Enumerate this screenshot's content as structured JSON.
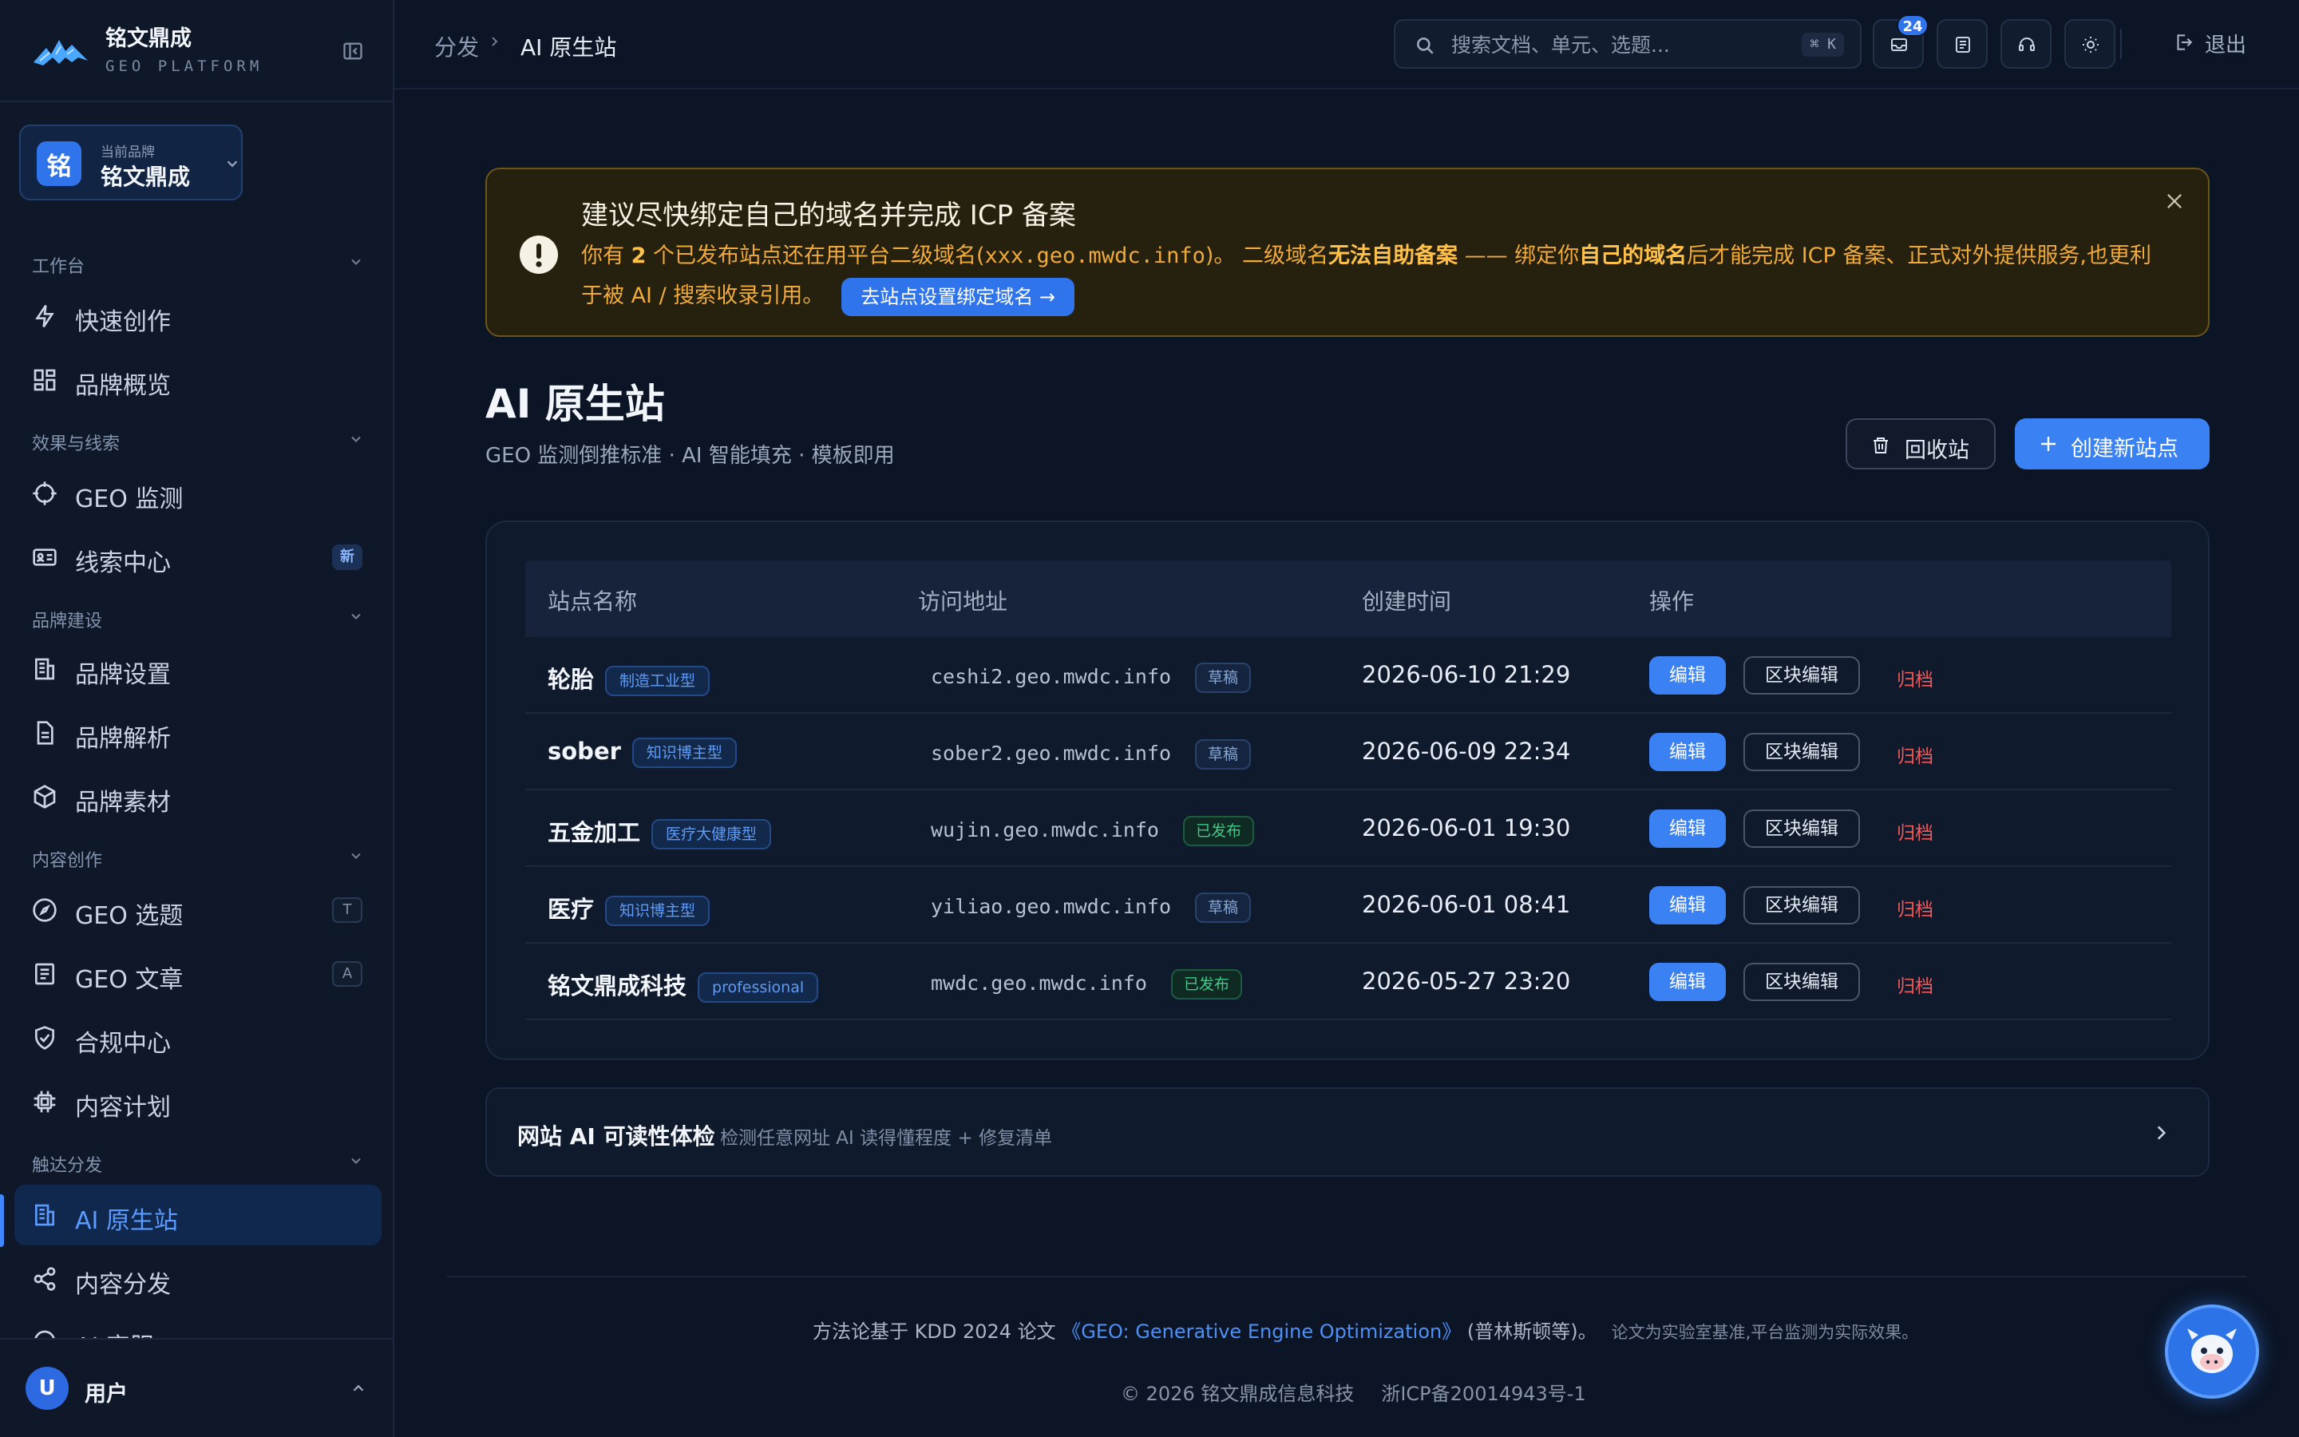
{
  "app": {
    "name": "铭文鼎成",
    "subtitle": "GEO PLATFORM"
  },
  "brand_switch": {
    "avatar": "铭",
    "label": "当前品牌",
    "name": "铭文鼎成"
  },
  "sidebar": {
    "sections": [
      {
        "title": "工作台"
      },
      {
        "title": "效果与线索"
      },
      {
        "title": "品牌建设"
      },
      {
        "title": "内容创作"
      },
      {
        "title": "触达分发"
      }
    ],
    "items": [
      {
        "label": "快速创作",
        "icon": "bolt-icon"
      },
      {
        "label": "品牌概览",
        "icon": "grid-icon"
      },
      {
        "label": "GEO 监测",
        "icon": "crosshair-icon"
      },
      {
        "label": "线索中心",
        "icon": "id-card-icon",
        "badge": "新"
      },
      {
        "label": "品牌设置",
        "icon": "building-icon"
      },
      {
        "label": "品牌解析",
        "icon": "document-icon"
      },
      {
        "label": "品牌素材",
        "icon": "box-icon"
      },
      {
        "label": "GEO 选题",
        "icon": "compass-icon",
        "shortcut": "T"
      },
      {
        "label": "GEO 文章",
        "icon": "article-icon",
        "shortcut": "A"
      },
      {
        "label": "合规中心",
        "icon": "shield-icon"
      },
      {
        "label": "内容计划",
        "icon": "chip-icon"
      },
      {
        "label": "AI 原生站",
        "icon": "building-icon",
        "active": true
      },
      {
        "label": "内容分发",
        "icon": "share-icon"
      },
      {
        "label": "AI 客服",
        "icon": "chat-icon"
      }
    ]
  },
  "user": {
    "avatar": "U",
    "name": "用户"
  },
  "topbar": {
    "breadcrumb": [
      "分发",
      "AI 原生站"
    ],
    "search_placeholder": "搜索文档、单元、选题...",
    "search_shortcut": "⌘ K",
    "notification_count": "24",
    "logout_label": "退出"
  },
  "banner": {
    "title": "建议尽快绑定自己的域名并完成 ICP 备案",
    "body_1": "你有 ",
    "count": "2",
    "body_2": " 个已发布站点还在用平台二级域名(",
    "domain_pattern": "xxx.geo.mwdc.info",
    "body_3": ")。 二级域名",
    "strong_1": "无法自助备案",
    "body_4": " —— 绑定你",
    "strong_2": "自己的域名",
    "body_5": "后才能完成 ICP 备案、正式对外提供服务,也更利于被 AI / 搜索收录引用。",
    "cta": "去站点设置绑定域名 →",
    "accent_color": "#f0a93b"
  },
  "page": {
    "title": "AI 原生站",
    "subtitle": "GEO 监测倒推标准 · AI 智能填充 · 模板即用",
    "trash_button": "回收站",
    "create_button": "创建新站点"
  },
  "table": {
    "columns": [
      "站点名称",
      "访问地址",
      "创建时间",
      "操作"
    ],
    "actions": {
      "edit": "编辑",
      "block_edit": "区块编辑",
      "archive": "归档"
    },
    "rows": [
      {
        "name": "轮胎",
        "type": "制造工业型",
        "url": "ceshi2.geo.mwdc.info",
        "status": "草稿",
        "status_kind": "draft",
        "created": "2026-06-10 21:29"
      },
      {
        "name": "sober",
        "type": "知识博主型",
        "url": "sober2.geo.mwdc.info",
        "status": "草稿",
        "status_kind": "draft",
        "created": "2026-06-09 22:34"
      },
      {
        "name": "五金加工",
        "type": "医疗大健康型",
        "url": "wujin.geo.mwdc.info",
        "status": "已发布",
        "status_kind": "published",
        "created": "2026-06-01 19:30"
      },
      {
        "name": "医疗",
        "type": "知识博主型",
        "url": "yiliao.geo.mwdc.info",
        "status": "草稿",
        "status_kind": "draft",
        "created": "2026-06-01 08:41"
      },
      {
        "name": "铭文鼎成科技",
        "type": "professional",
        "url": "mwdc.geo.mwdc.info",
        "status": "已发布",
        "status_kind": "published",
        "created": "2026-05-27 23:20"
      }
    ]
  },
  "readability": {
    "title": "网站 AI 可读性体检",
    "description": "检测任意网址 AI 读得懂程度 + 修复清单"
  },
  "footer": {
    "method_prefix": "方法论基于 KDD 2024 论文 ",
    "paper": "《GEO: Generative Engine Optimization》",
    "method_suffix": " (普林斯顿等)。",
    "note": "论文为实验室基准,平台监测为实际效果。",
    "copyright": "© 2026 铭文鼎成信息科技",
    "icp": "浙ICP备20014943号-1"
  },
  "colors": {
    "accent": "#3a81f3",
    "background": "#0c1526",
    "danger": "#ef5a5a",
    "success": "#43c788"
  }
}
